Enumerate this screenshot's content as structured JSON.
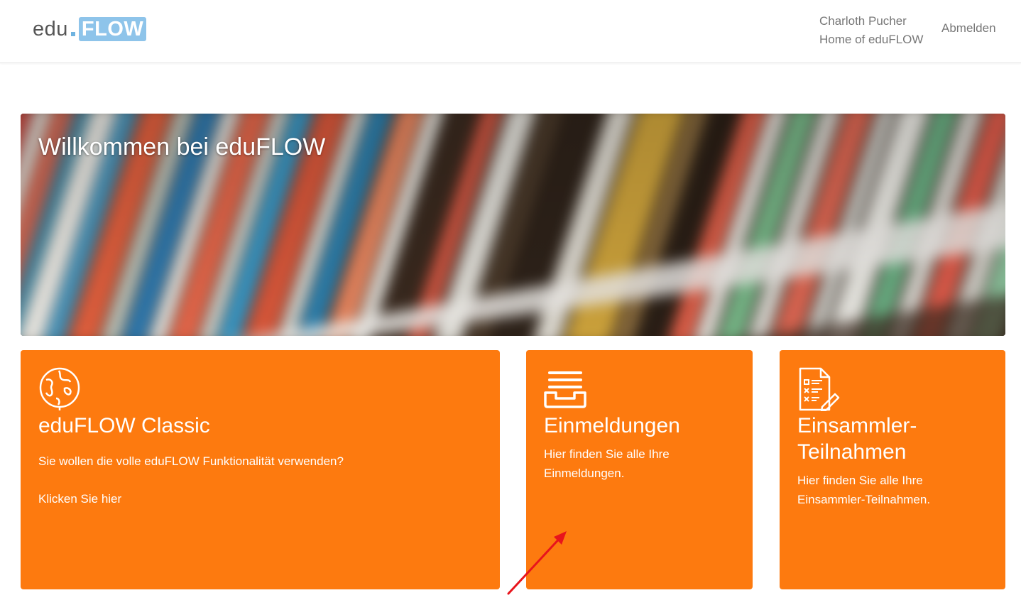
{
  "header": {
    "logo_left": "edu",
    "logo_right": "FLOW",
    "user_name": "Charloth Pucher",
    "user_home": "Home of eduFLOW",
    "logout_label": "Abmelden"
  },
  "hero": {
    "title": "Willkommen bei eduFLOW"
  },
  "cards": [
    {
      "icon": "globe-icon",
      "title": "eduFLOW Classic",
      "text": "Sie wollen die volle eduFLOW Funktionalität verwenden?",
      "link": "Klicken Sie hier"
    },
    {
      "icon": "inbox-tray-icon",
      "title": "Einmeldungen",
      "text": "Hier finden Sie alle Ihre Einmeldungen."
    },
    {
      "icon": "checklist-document-icon",
      "title": "Einsammler-Teilnahmen",
      "text": "Hier finden Sie alle Ihre Einsammler-Teilnahmen."
    }
  ],
  "colors": {
    "card": "#fd7a0f",
    "logo_accent": "#8ec4ea",
    "annotation_arrow": "#e8141c"
  }
}
